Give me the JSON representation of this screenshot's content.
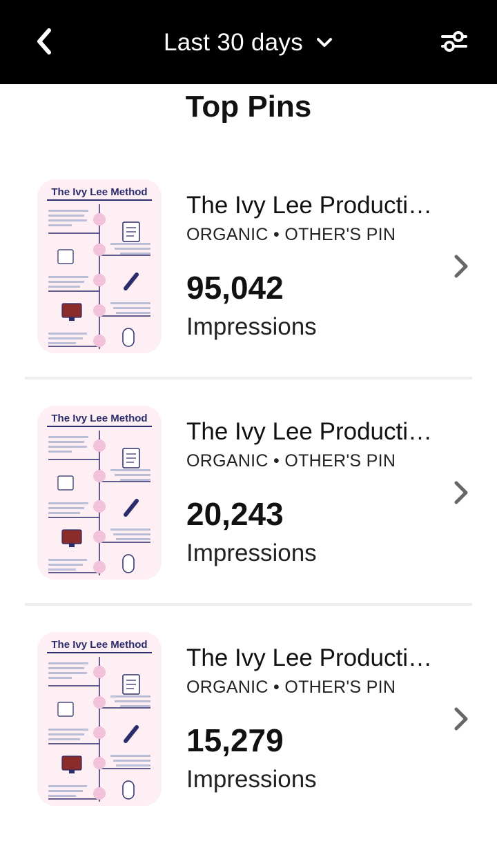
{
  "header": {
    "date_range_label": "Last 30 days"
  },
  "page": {
    "title": "Top Pins"
  },
  "pins": [
    {
      "title": "The Ivy Lee Producti…",
      "tags": "ORGANIC • OTHER'S PIN",
      "value": "95,042",
      "metric": "Impressions",
      "thumbnail_title": "The Ivy Lee Method"
    },
    {
      "title": "The Ivy Lee Producti…",
      "tags": "ORGANIC • OTHER'S PIN",
      "value": "20,243",
      "metric": "Impressions",
      "thumbnail_title": "The Ivy Lee Method"
    },
    {
      "title": "The Ivy Lee Producti…",
      "tags": "ORGANIC • OTHER'S PIN",
      "value": "15,279",
      "metric": "Impressions",
      "thumbnail_title": "The Ivy Lee Method"
    }
  ],
  "icons": {
    "back": "chevron-left-icon",
    "date_range": "chevron-down-icon",
    "filter": "sliders-icon",
    "row": "chevron-right-icon"
  },
  "colors": {
    "header_background": "#000000",
    "thumbnail_background": "#fdeff4",
    "thumbnail_accent": "#2b2c6b",
    "divider": "#eeeeee"
  }
}
